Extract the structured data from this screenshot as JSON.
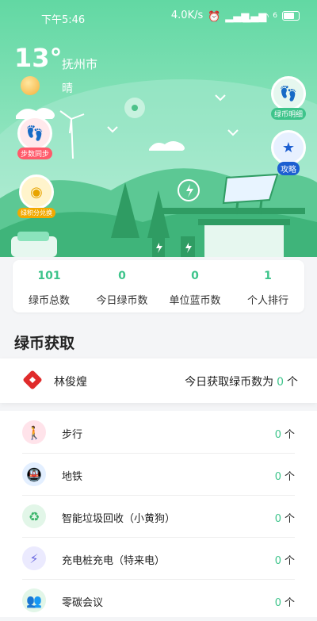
{
  "status_bar": {
    "time": "下午5:46",
    "network_speed": "4.0K/s",
    "wifi_badge": "6"
  },
  "weather": {
    "temperature": "13°",
    "city": "抚州市",
    "condition": "晴"
  },
  "side_buttons": {
    "step_sync": "步数同步",
    "points_exchange": "绿积分兑换",
    "green_detail": "绿币明细",
    "strategy": "攻略"
  },
  "stats": [
    {
      "value": "101",
      "label": "绿币总数"
    },
    {
      "value": "0",
      "label": "今日绿币数"
    },
    {
      "value": "0",
      "label": "单位蓝币数"
    },
    {
      "value": "1",
      "label": "个人排行"
    }
  ],
  "section_title": "绿币获取",
  "user": {
    "name": "林俊煌",
    "today_prefix": "今日获取绿币数为",
    "today_count": "0",
    "unit": "个"
  },
  "activities": [
    {
      "label": "步行",
      "count": "0",
      "unit": "个",
      "icon": "walking-icon",
      "color": "#f7a8b8"
    },
    {
      "label": "地铁",
      "count": "0",
      "unit": "个",
      "icon": "subway-icon",
      "color": "#7fb3f0"
    },
    {
      "label": "智能垃圾回收（小黄狗）",
      "count": "0",
      "unit": "个",
      "icon": "recycle-bin-icon",
      "color": "#6fd28f"
    },
    {
      "label": "充电桩充电（特来电）",
      "count": "0",
      "unit": "个",
      "icon": "charging-pile-icon",
      "color": "#9d9ef0"
    },
    {
      "label": "零碳会议",
      "count": "0",
      "unit": "个",
      "icon": "meeting-icon",
      "color": "#6fd28f"
    }
  ]
}
